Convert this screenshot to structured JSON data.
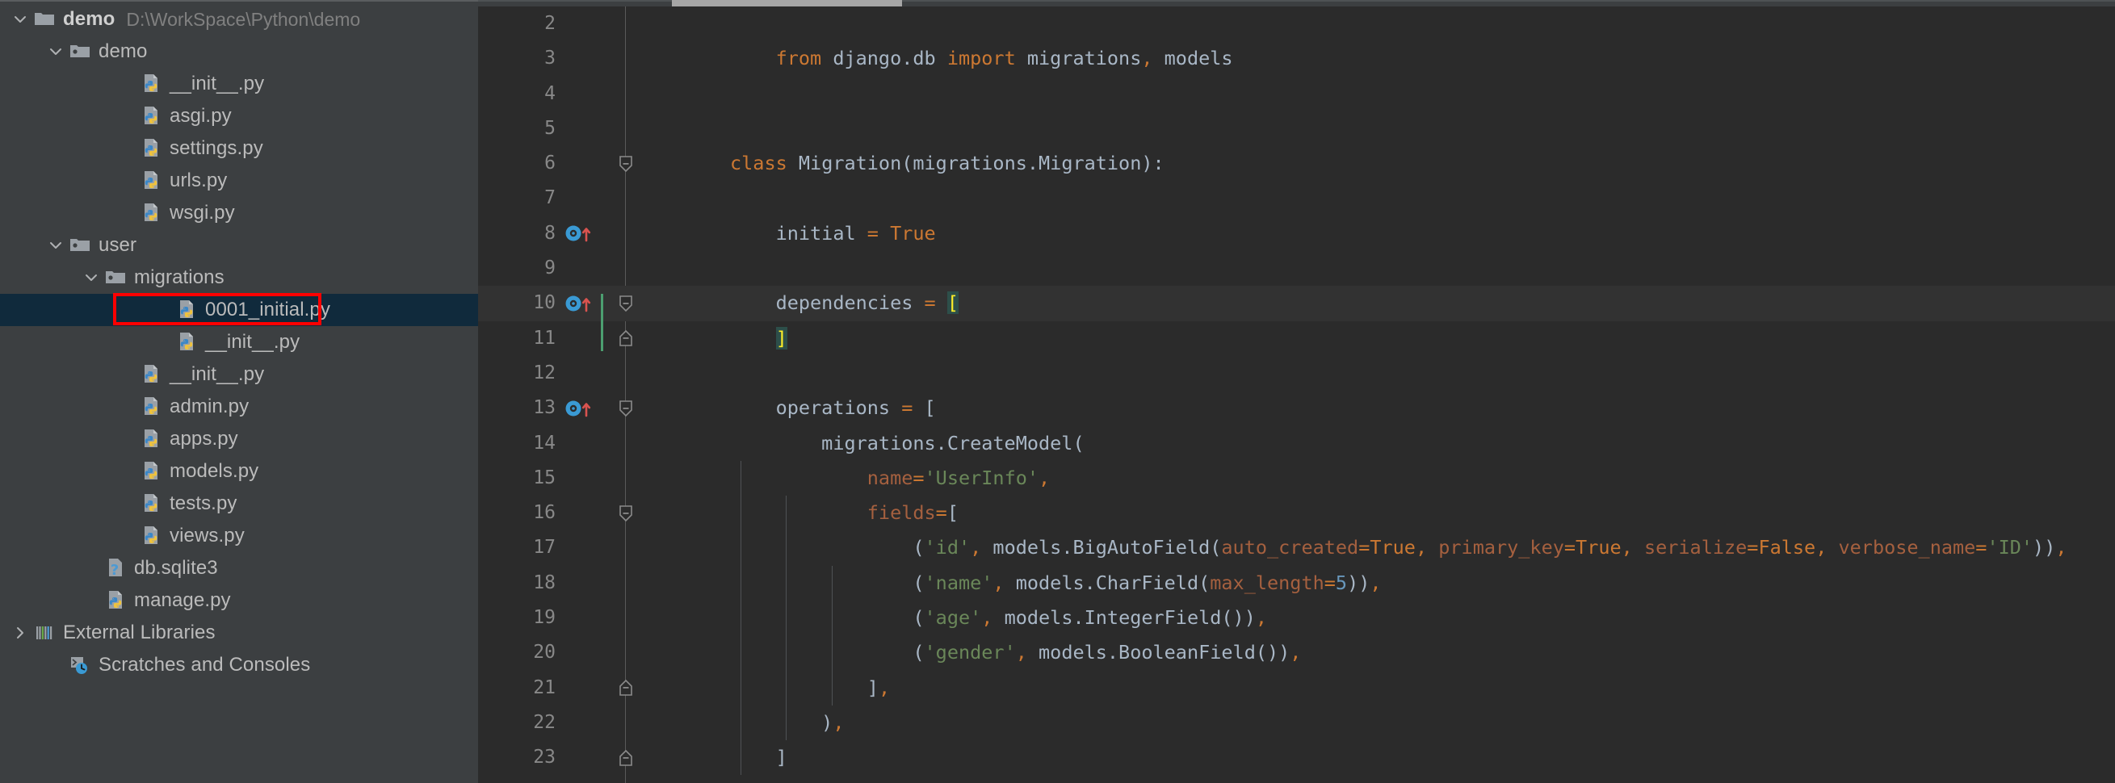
{
  "sidebar": {
    "tree": [
      {
        "indent": 0,
        "twisty": "chevron-down-icon",
        "icon": "folder-module-icon",
        "label": "demo",
        "bold": true,
        "path": "D:\\WorkSpace\\Python\\demo",
        "name": "tree-item-demo-root"
      },
      {
        "indent": 1,
        "twisty": "chevron-down-icon",
        "icon": "folder-package-icon",
        "label": "demo",
        "bold": false,
        "path": "",
        "name": "tree-item-demo-package"
      },
      {
        "indent": 3,
        "twisty": "",
        "icon": "python-file-icon",
        "label": "__init__.py",
        "bold": false,
        "path": "",
        "name": "tree-item-init-py-demo"
      },
      {
        "indent": 3,
        "twisty": "",
        "icon": "python-file-icon",
        "label": "asgi.py",
        "bold": false,
        "path": "",
        "name": "tree-item-asgi-py"
      },
      {
        "indent": 3,
        "twisty": "",
        "icon": "python-file-icon",
        "label": "settings.py",
        "bold": false,
        "path": "",
        "name": "tree-item-settings-py"
      },
      {
        "indent": 3,
        "twisty": "",
        "icon": "python-file-icon",
        "label": "urls.py",
        "bold": false,
        "path": "",
        "name": "tree-item-urls-py"
      },
      {
        "indent": 3,
        "twisty": "",
        "icon": "python-file-icon",
        "label": "wsgi.py",
        "bold": false,
        "path": "",
        "name": "tree-item-wsgi-py"
      },
      {
        "indent": 1,
        "twisty": "chevron-down-icon",
        "icon": "folder-package-icon",
        "label": "user",
        "bold": false,
        "path": "",
        "name": "tree-item-user-package"
      },
      {
        "indent": 2,
        "twisty": "chevron-down-icon",
        "icon": "folder-package-icon",
        "label": "migrations",
        "bold": false,
        "path": "",
        "name": "tree-item-migrations-package"
      },
      {
        "indent": 4,
        "twisty": "",
        "icon": "python-file-icon",
        "label": "0001_initial.py",
        "bold": false,
        "path": "",
        "selected": true,
        "highlight": true,
        "name": "tree-item-0001-initial-py"
      },
      {
        "indent": 4,
        "twisty": "",
        "icon": "python-file-icon",
        "label": "__init__.py",
        "bold": false,
        "path": "",
        "name": "tree-item-init-py-migrations"
      },
      {
        "indent": 3,
        "twisty": "",
        "icon": "python-file-icon",
        "label": "__init__.py",
        "bold": false,
        "path": "",
        "name": "tree-item-init-py-user"
      },
      {
        "indent": 3,
        "twisty": "",
        "icon": "python-file-icon",
        "label": "admin.py",
        "bold": false,
        "path": "",
        "name": "tree-item-admin-py"
      },
      {
        "indent": 3,
        "twisty": "",
        "icon": "python-file-icon",
        "label": "apps.py",
        "bold": false,
        "path": "",
        "name": "tree-item-apps-py"
      },
      {
        "indent": 3,
        "twisty": "",
        "icon": "python-file-icon",
        "label": "models.py",
        "bold": false,
        "path": "",
        "name": "tree-item-models-py"
      },
      {
        "indent": 3,
        "twisty": "",
        "icon": "python-file-icon",
        "label": "tests.py",
        "bold": false,
        "path": "",
        "name": "tree-item-tests-py"
      },
      {
        "indent": 3,
        "twisty": "",
        "icon": "python-file-icon",
        "label": "views.py",
        "bold": false,
        "path": "",
        "name": "tree-item-views-py"
      },
      {
        "indent": 2,
        "twisty": "",
        "icon": "unknown-file-icon",
        "label": "db.sqlite3",
        "bold": false,
        "path": "",
        "name": "tree-item-db-sqlite3"
      },
      {
        "indent": 2,
        "twisty": "",
        "icon": "python-file-icon",
        "label": "manage.py",
        "bold": false,
        "path": "",
        "name": "tree-item-manage-py"
      },
      {
        "indent": 0,
        "twisty": "chevron-right-icon",
        "icon": "external-libraries-icon",
        "label": "External Libraries",
        "bold": false,
        "path": "",
        "name": "tree-item-external-libraries"
      },
      {
        "indent": 1,
        "twisty": "",
        "icon": "scratches-icon",
        "label": "Scratches and Consoles",
        "bold": false,
        "path": "",
        "name": "tree-item-scratches-and-consoles"
      }
    ]
  },
  "editor": {
    "lines": [
      {
        "num": "2",
        "gutter": "",
        "fold": "",
        "caret": false,
        "tokens": []
      },
      {
        "num": "3",
        "gutter": "",
        "fold": "",
        "caret": false,
        "tokens": [
          {
            "t": "    ",
            "c": "id"
          },
          {
            "t": "from",
            "c": "kw"
          },
          {
            "t": " django.db ",
            "c": "id"
          },
          {
            "t": "import",
            "c": "kw"
          },
          {
            "t": " migrations",
            "c": "id"
          },
          {
            "t": ",",
            "c": "comma"
          },
          {
            "t": " models",
            "c": "id"
          }
        ]
      },
      {
        "num": "4",
        "gutter": "",
        "fold": "",
        "caret": false,
        "tokens": []
      },
      {
        "num": "5",
        "gutter": "",
        "fold": "",
        "caret": false,
        "tokens": []
      },
      {
        "num": "6",
        "gutter": "",
        "fold": "fold-collapse-top",
        "caret": false,
        "tokens": [
          {
            "t": "class",
            "c": "kw"
          },
          {
            "t": " Migration",
            "c": "id"
          },
          {
            "t": "(",
            "c": "punct"
          },
          {
            "t": "migrations.Migration",
            "c": "id"
          },
          {
            "t": "):",
            "c": "punct"
          }
        ]
      },
      {
        "num": "7",
        "gutter": "",
        "fold": "",
        "caret": false,
        "tokens": []
      },
      {
        "num": "8",
        "gutter": "field-override-icon",
        "fold": "",
        "caret": false,
        "tokens": [
          {
            "t": "    initial ",
            "c": "id"
          },
          {
            "t": "=",
            "c": "kw"
          },
          {
            "t": " ",
            "c": "id"
          },
          {
            "t": "True",
            "c": "cons"
          }
        ]
      },
      {
        "num": "9",
        "gutter": "",
        "fold": "",
        "caret": false,
        "tokens": []
      },
      {
        "num": "10",
        "gutter": "field-override-icon",
        "fold": "fold-collapse-top",
        "caret": true,
        "tokens": [
          {
            "t": "    dependencies ",
            "c": "id"
          },
          {
            "t": "=",
            "c": "kw"
          },
          {
            "t": " ",
            "c": "id"
          },
          {
            "t": "[",
            "c": "brmatch"
          }
        ]
      },
      {
        "num": "11",
        "gutter": "",
        "fold": "fold-collapse-bottom",
        "caret": false,
        "tokens": [
          {
            "t": "    ",
            "c": "id"
          },
          {
            "t": "]",
            "c": "brmatch"
          }
        ]
      },
      {
        "num": "12",
        "gutter": "",
        "fold": "",
        "caret": false,
        "tokens": []
      },
      {
        "num": "13",
        "gutter": "field-override-icon",
        "fold": "fold-collapse-top",
        "caret": false,
        "tokens": [
          {
            "t": "    operations ",
            "c": "id"
          },
          {
            "t": "=",
            "c": "kw"
          },
          {
            "t": " ",
            "c": "id"
          },
          {
            "t": "[",
            "c": "punct"
          }
        ]
      },
      {
        "num": "14",
        "gutter": "",
        "fold": "",
        "caret": false,
        "tokens": [
          {
            "t": "        migrations.CreateModel",
            "c": "id"
          },
          {
            "t": "(",
            "c": "punct"
          }
        ]
      },
      {
        "num": "15",
        "gutter": "",
        "fold": "",
        "caret": false,
        "tokens": [
          {
            "t": "            ",
            "c": "id"
          },
          {
            "t": "name",
            "c": "kwarg"
          },
          {
            "t": "=",
            "c": "kw"
          },
          {
            "t": "'UserInfo'",
            "c": "str"
          },
          {
            "t": ",",
            "c": "comma"
          }
        ]
      },
      {
        "num": "16",
        "gutter": "",
        "fold": "fold-collapse-top",
        "caret": false,
        "tokens": [
          {
            "t": "            ",
            "c": "id"
          },
          {
            "t": "fields",
            "c": "kwarg"
          },
          {
            "t": "=",
            "c": "kw"
          },
          {
            "t": "[",
            "c": "punct"
          }
        ]
      },
      {
        "num": "17",
        "gutter": "",
        "fold": "",
        "caret": false,
        "tokens": [
          {
            "t": "                (",
            "c": "punct"
          },
          {
            "t": "'id'",
            "c": "str"
          },
          {
            "t": ",",
            "c": "comma"
          },
          {
            "t": " models.BigAutoField",
            "c": "id"
          },
          {
            "t": "(",
            "c": "punct"
          },
          {
            "t": "auto_created",
            "c": "kwarg"
          },
          {
            "t": "=",
            "c": "kw"
          },
          {
            "t": "True",
            "c": "cons"
          },
          {
            "t": ",",
            "c": "comma"
          },
          {
            "t": " ",
            "c": "id"
          },
          {
            "t": "primary_key",
            "c": "kwarg"
          },
          {
            "t": "=",
            "c": "kw"
          },
          {
            "t": "True",
            "c": "cons"
          },
          {
            "t": ",",
            "c": "comma"
          },
          {
            "t": " ",
            "c": "id"
          },
          {
            "t": "serialize",
            "c": "kwarg"
          },
          {
            "t": "=",
            "c": "kw"
          },
          {
            "t": "False",
            "c": "cons"
          },
          {
            "t": ",",
            "c": "comma"
          },
          {
            "t": " ",
            "c": "id"
          },
          {
            "t": "verbose_name",
            "c": "kwarg"
          },
          {
            "t": "=",
            "c": "kw"
          },
          {
            "t": "'ID'",
            "c": "str"
          },
          {
            "t": "))",
            "c": "punct"
          },
          {
            "t": ",",
            "c": "comma"
          }
        ]
      },
      {
        "num": "18",
        "gutter": "",
        "fold": "",
        "caret": false,
        "tokens": [
          {
            "t": "                (",
            "c": "punct"
          },
          {
            "t": "'name'",
            "c": "str"
          },
          {
            "t": ",",
            "c": "comma"
          },
          {
            "t": " models.CharField",
            "c": "id"
          },
          {
            "t": "(",
            "c": "punct"
          },
          {
            "t": "max_length",
            "c": "kwarg"
          },
          {
            "t": "=",
            "c": "kw"
          },
          {
            "t": "5",
            "c": "num"
          },
          {
            "t": "))",
            "c": "punct"
          },
          {
            "t": ",",
            "c": "comma"
          }
        ]
      },
      {
        "num": "19",
        "gutter": "",
        "fold": "",
        "caret": false,
        "tokens": [
          {
            "t": "                (",
            "c": "punct"
          },
          {
            "t": "'age'",
            "c": "str"
          },
          {
            "t": ",",
            "c": "comma"
          },
          {
            "t": " models.IntegerField",
            "c": "id"
          },
          {
            "t": "())",
            "c": "punct"
          },
          {
            "t": ",",
            "c": "comma"
          }
        ]
      },
      {
        "num": "20",
        "gutter": "",
        "fold": "",
        "caret": false,
        "tokens": [
          {
            "t": "                (",
            "c": "punct"
          },
          {
            "t": "'gender'",
            "c": "str"
          },
          {
            "t": ",",
            "c": "comma"
          },
          {
            "t": " models.BooleanField",
            "c": "id"
          },
          {
            "t": "())",
            "c": "punct"
          },
          {
            "t": ",",
            "c": "comma"
          }
        ]
      },
      {
        "num": "21",
        "gutter": "",
        "fold": "fold-collapse-bottom",
        "caret": false,
        "tokens": [
          {
            "t": "            ]",
            "c": "punct"
          },
          {
            "t": ",",
            "c": "comma"
          }
        ]
      },
      {
        "num": "22",
        "gutter": "",
        "fold": "",
        "caret": false,
        "tokens": [
          {
            "t": "        )",
            "c": "punct"
          },
          {
            "t": ",",
            "c": "comma"
          }
        ]
      },
      {
        "num": "23",
        "gutter": "",
        "fold": "fold-collapse-bottom",
        "caret": false,
        "tokens": [
          {
            "t": "    ]",
            "c": "punct"
          }
        ]
      }
    ]
  },
  "colors": {
    "editor_bg": "#2b2b2b",
    "sidebar_bg": "#3c3f41",
    "selection_bg": "#102a3c",
    "highlight_box": "#ff0000",
    "keyword": "#cc7832",
    "string": "#6a8759",
    "number": "#6897bb",
    "identifier": "#a9b7c6",
    "kwarg": "#a5603f",
    "bracket_match": "#ffef28"
  }
}
